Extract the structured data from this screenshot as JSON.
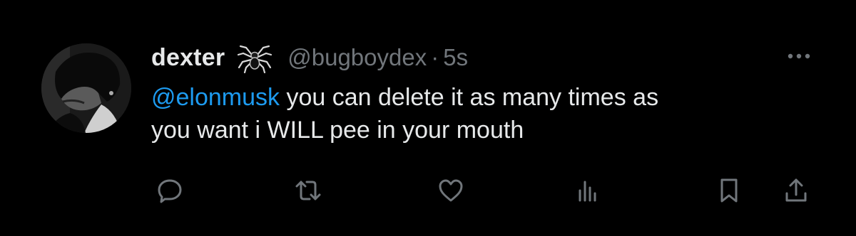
{
  "tweet": {
    "author": {
      "display_name": "dexter",
      "handle": "@bugboydex",
      "separator": "·",
      "time": "5s",
      "emoji_icon": "spider-icon",
      "avatar": "user-avatar"
    },
    "text": {
      "mention": "@elonmusk",
      "line1_rest": " you can delete it as many times as",
      "line2": "you want i WILL pee in your mouth"
    },
    "more_icon": "ellipsis-icon",
    "actions": [
      {
        "name": "reply",
        "icon": "reply-icon"
      },
      {
        "name": "repost",
        "icon": "repost-icon"
      },
      {
        "name": "like",
        "icon": "heart-icon"
      },
      {
        "name": "views",
        "icon": "views-icon"
      },
      {
        "name": "bookmark",
        "icon": "bookmark-icon"
      },
      {
        "name": "share",
        "icon": "share-icon"
      }
    ]
  },
  "colors": {
    "background": "#000000",
    "text_primary": "#e7e9ea",
    "text_secondary": "#71767b",
    "accent": "#1d9bf0"
  }
}
